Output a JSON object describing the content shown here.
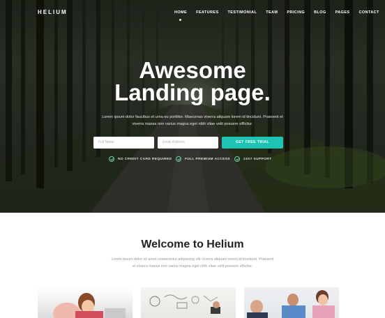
{
  "nav": {
    "logo": "HELIUM",
    "items": [
      "HOME",
      "FEATURES",
      "TESTIMONIAL",
      "TEAM",
      "PRICING",
      "BLOG",
      "PAGES",
      "CONTACT"
    ]
  },
  "hero": {
    "title_line1": "Awesome",
    "title_line2": "Landing page.",
    "subtitle_line1": "Lorem ipsum dolor faucibus et urna eu porttitor. Maecenas viverra aliquam lorem id tincidunt. Praesent et",
    "subtitle_line2": "viverra massa non varius magna eget nibh vitae velit posuere efficitur.",
    "name_placeholder": "Full Name",
    "email_placeholder": "Email Address",
    "cta_label": "GET FREE TRIAL",
    "features": [
      "NO CREDIT CARD REQUIRED",
      "FULL PREMIUM ACCESS",
      "24X7 SUPPORT"
    ]
  },
  "welcome": {
    "title": "Welcome to Helium",
    "text_line1": "Lorem ipsum dolor sit amet consectetur adipiscing elit viverra aliquam lorem id tincidunt. Praesent",
    "text_line2": "et viverra massa non varius magna eget nibh vitae velit posuere efficitur."
  },
  "colors": {
    "accent": "#1fc3b4",
    "check": "#6fd0a0",
    "heading": "#222222",
    "muted": "#999999"
  }
}
